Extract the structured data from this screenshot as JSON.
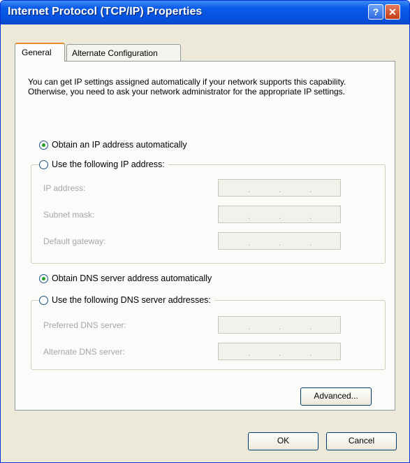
{
  "window": {
    "title": "Internet Protocol (TCP/IP) Properties",
    "help_label": "?",
    "close_label": "✕"
  },
  "tabs": [
    {
      "label": "General",
      "selected": true
    },
    {
      "label": "Alternate Configuration",
      "selected": false
    }
  ],
  "general": {
    "intro": "You can get IP settings assigned automatically if your network supports this capability. Otherwise, you need to ask your network administrator for the appropriate IP settings.",
    "ip": {
      "auto_label": "Obtain an IP address automatically",
      "manual_label": "Use the following IP address:",
      "selected": "auto",
      "fields": [
        {
          "label": "IP address:",
          "value": ""
        },
        {
          "label": "Subnet mask:",
          "value": ""
        },
        {
          "label": "Default gateway:",
          "value": ""
        }
      ]
    },
    "dns": {
      "auto_label": "Obtain DNS server address automatically",
      "manual_label": "Use the following DNS server addresses:",
      "selected": "auto",
      "fields": [
        {
          "label": "Preferred DNS server:",
          "value": ""
        },
        {
          "label": "Alternate DNS server:",
          "value": ""
        }
      ]
    },
    "advanced_label": "Advanced..."
  },
  "buttons": {
    "ok_label": "OK",
    "cancel_label": "Cancel"
  },
  "ip_separator": "."
}
